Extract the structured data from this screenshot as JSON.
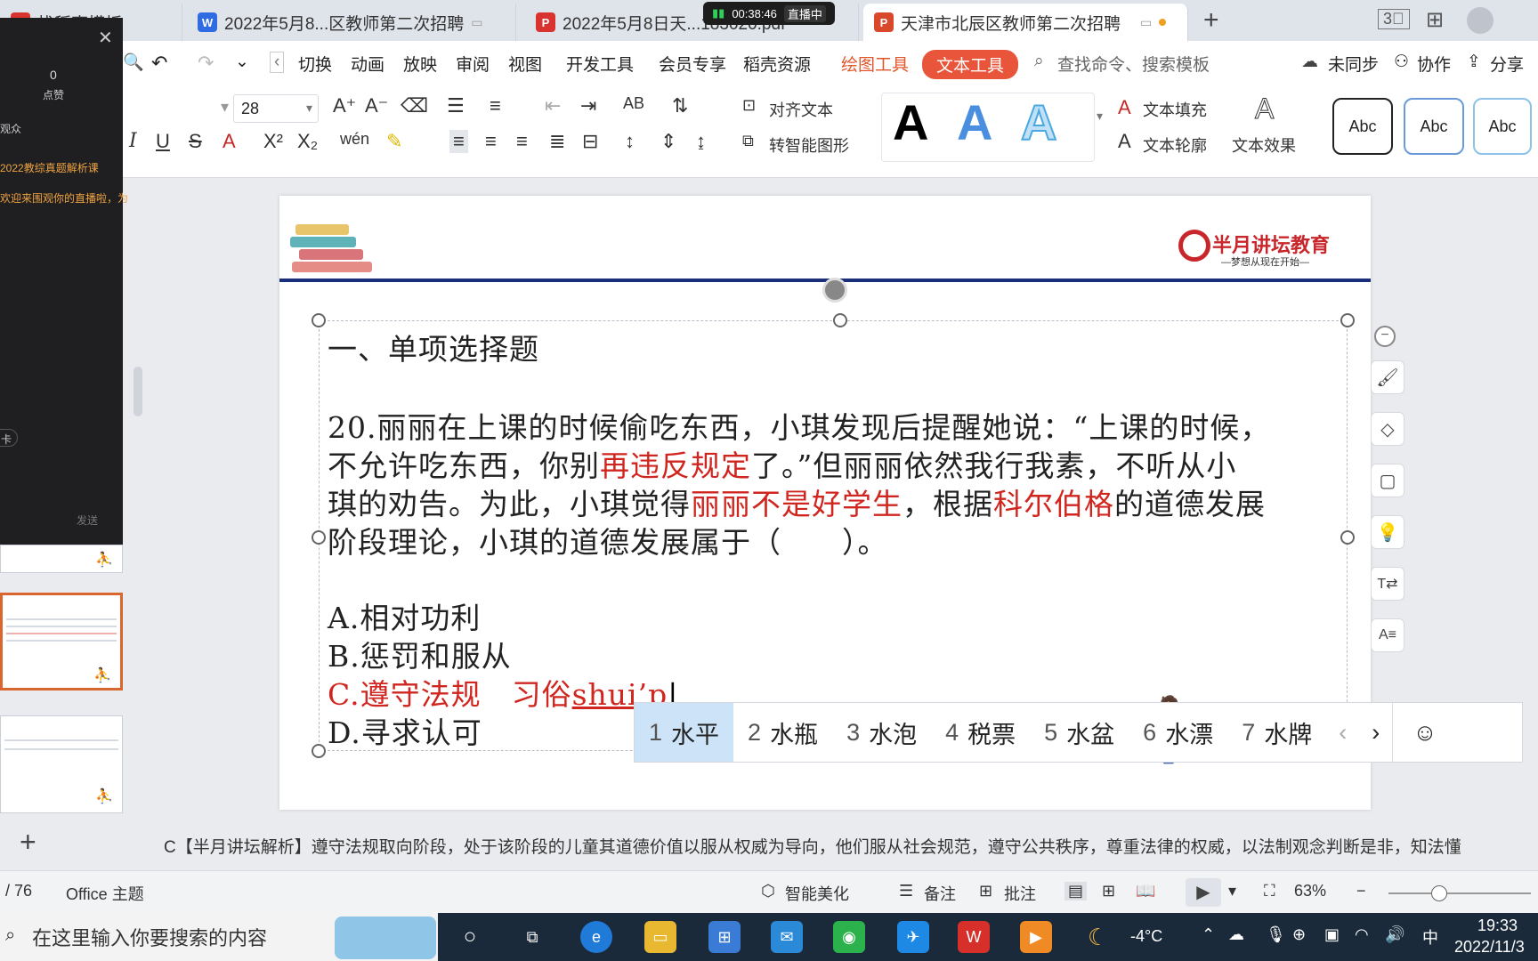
{
  "tabs": [
    {
      "label": "找稻壳模板",
      "icon": "wps-d-icon"
    },
    {
      "label": "2022年5月8...区教师第二次招聘",
      "icon": "word-doc-icon"
    },
    {
      "label": "2022年5月8日天...183020.pdf",
      "icon": "pdf-doc-icon"
    },
    {
      "label": "天津市北辰区教师第二次招聘",
      "icon": "ppt-doc-icon"
    }
  ],
  "live": {
    "timer": "00:38:46",
    "status": "直播中"
  },
  "menu": {
    "items": [
      "切换",
      "动画",
      "放映",
      "审阅",
      "视图",
      "开发工具",
      "会员专享",
      "稻壳资源"
    ],
    "drawing_tools": "绘图工具",
    "text_tools": "文本工具",
    "search_placeholder": "查找命令、搜索模板",
    "unsynced": "未同步",
    "collab": "协作",
    "share": "分享"
  },
  "toolbar": {
    "font_size": "28",
    "align_text": "对齐文本",
    "smart_shape": "转智能图形",
    "text_fill": "文本填充",
    "text_outline": "文本轮廓",
    "text_effect": "文本效果",
    "style_samples": [
      "Abc",
      "Abc",
      "Abc"
    ],
    "wordart": [
      "A",
      "A",
      "A"
    ]
  },
  "livepanel": {
    "likes_count": "0",
    "likes_label": "点赞",
    "audience": "观众",
    "course": "2022教综真题解析课",
    "welcome": "欢迎来围观你的直播啦，为",
    "send": "发送",
    "misc": "卡"
  },
  "slide": {
    "logo_name": "半月讲坛教育",
    "logo_slogan": "—梦想从现在开始—",
    "heading": "一、单项选择题",
    "q_line1": "20.丽丽在上课的时候偷吃东西，小琪发现后提醒她说：“上课的时候，",
    "q_line2_a": "不允许吃东西，你别",
    "q_line2_red": "再违反规定",
    "q_line2_b": "了。”但丽丽依然我行我素，不听从小",
    "q_line3_a": "琪的劝告。为此，小琪觉得",
    "q_line3_red1": "丽丽不是好学生",
    "q_line3_b": "，根据",
    "q_line3_red2": "科尔伯格",
    "q_line3_c": "的道德发展",
    "q_line4": "阶段理论，小琪的道德发展属于（　　）。",
    "opt_a": "A.相对功利",
    "opt_b": "B.惩罚和服从",
    "opt_c": "C.遵守法规　习俗",
    "opt_c_input": "shui’p",
    "opt_d": "D.寻求认可"
  },
  "ime": {
    "candidates": [
      {
        "n": "1",
        "w": "水平"
      },
      {
        "n": "2",
        "w": "水瓶"
      },
      {
        "n": "3",
        "w": "水泡"
      },
      {
        "n": "4",
        "w": "税票"
      },
      {
        "n": "5",
        "w": "水盆"
      },
      {
        "n": "6",
        "w": "水漂"
      },
      {
        "n": "7",
        "w": "水牌"
      }
    ]
  },
  "notes": "C【半月讲坛解析】遵守法规取向阶段，处于该阶段的儿童其道德价值以服从权威为导向，他们服从社会规范，遵守公共秩序，尊重法律的权威，以法制观念判断是非，知法懂",
  "status": {
    "page": "/ 76",
    "theme": "Office 主题",
    "beautify": "智能美化",
    "notes": "备注",
    "comment": "批注",
    "zoom": "63%"
  },
  "taskbar": {
    "search_placeholder": "在这里输入你要搜索的内容",
    "weather": "-4°C",
    "ime": "中",
    "time": "19:33",
    "date": "2022/11/3"
  }
}
